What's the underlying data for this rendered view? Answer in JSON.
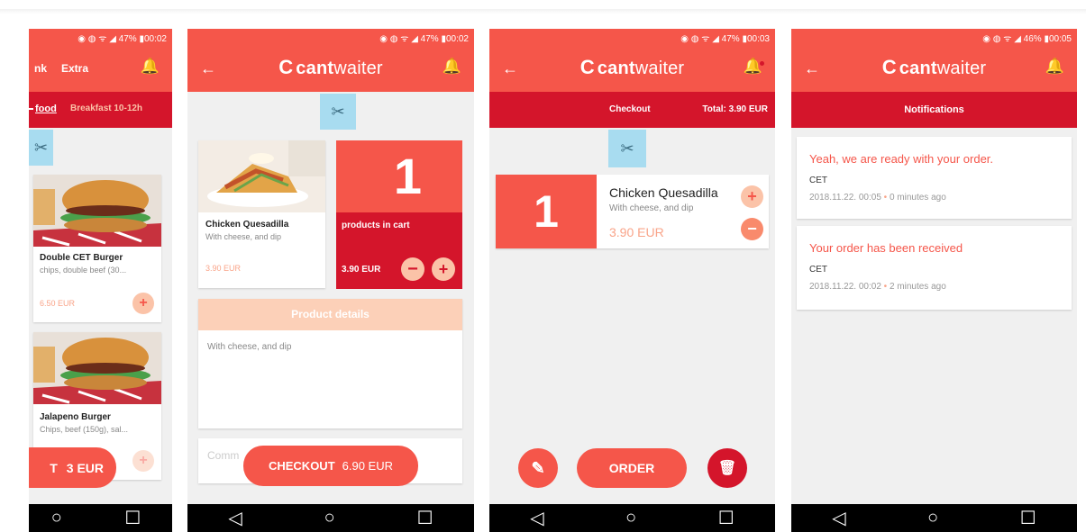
{
  "status": {
    "p1": "◉ ◍ ᯤ ◢ 47% ▮00:02",
    "p2": "◉ ◍ ᯤ ◢ 47% ▮00:02",
    "p3": "◉ ◍ ᯤ ◢ 47% ▮00:03",
    "p4": "◉ ◍ ᯤ ◢ 46% ▮00:05"
  },
  "brand": {
    "prefix": "cant",
    "suffix": "waiter",
    "c_symbol": "C",
    "color": "#f5564a",
    "dark": "#d4152b"
  },
  "nav_icons": {
    "back": "◁",
    "home": "○",
    "recent": "☐"
  },
  "menu": {
    "tabs": [
      "nk",
      "Extra"
    ],
    "categories": [
      "food",
      "Breakfast 10-12h"
    ],
    "items": [
      {
        "name": "Double CET Burger",
        "desc": "chips, double beef (30...",
        "price": "6.50 EUR"
      },
      {
        "name": "Jalapeno Burger",
        "desc": "Chips, beef (150g), sal...",
        "price": ""
      }
    ],
    "checkout_fragment": "T",
    "checkout_price": "3 EUR"
  },
  "detail": {
    "product_name": "Chicken Quesadilla",
    "product_desc": "With cheese, and dip",
    "product_price": "3.90 EUR",
    "cart_count": "1",
    "cart_label": "products in cart",
    "cart_price": "3.90 EUR",
    "details_header": "Product details",
    "details_text": "With cheese, and dip",
    "comment_placeholder": "Comm",
    "checkout_label": "CHECKOUT",
    "checkout_total": "6.90 EUR"
  },
  "cart": {
    "tab_checkout": "Checkout",
    "tab_total": "Total: 3.90 EUR",
    "qty": "1",
    "item_name": "Chicken Quesadilla",
    "item_desc": "With cheese, and dip",
    "item_price": "3.90 EUR",
    "order_label": "ORDER"
  },
  "notifications": {
    "title": "Notifications",
    "items": [
      {
        "text": "Yeah, we are ready with your order.",
        "sender": "CET",
        "time": "2018.11.22. 00:05",
        "ago": "0 minutes ago"
      },
      {
        "text": "Your order has been received",
        "sender": "CET",
        "time": "2018.11.22. 00:02",
        "ago": "2 minutes ago"
      }
    ]
  }
}
